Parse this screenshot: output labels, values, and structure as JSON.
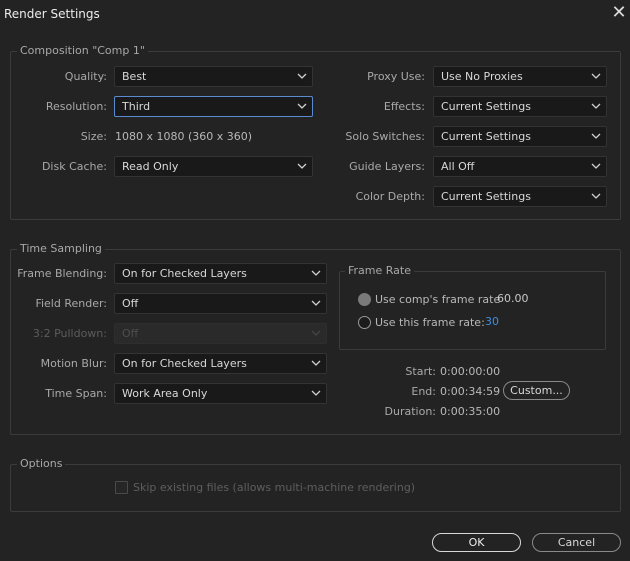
{
  "window": {
    "title": "Render Settings",
    "close_glyph": "✕"
  },
  "composition": {
    "title": "Composition \"Comp 1\"",
    "quality": {
      "label": "Quality:",
      "value": "Best"
    },
    "resolution": {
      "label": "Resolution:",
      "value": "Third"
    },
    "size": {
      "label": "Size:",
      "value": "1080 x 1080 (360 x 360)"
    },
    "disk_cache": {
      "label": "Disk Cache:",
      "value": "Read Only"
    },
    "proxy_use": {
      "label": "Proxy Use:",
      "value": "Use No Proxies"
    },
    "effects": {
      "label": "Effects:",
      "value": "Current Settings"
    },
    "solo_switches": {
      "label": "Solo Switches:",
      "value": "Current Settings"
    },
    "guide_layers": {
      "label": "Guide Layers:",
      "value": "All Off"
    },
    "color_depth": {
      "label": "Color Depth:",
      "value": "Current Settings"
    }
  },
  "time_sampling": {
    "title": "Time Sampling",
    "frame_blending": {
      "label": "Frame Blending:",
      "value": "On for Checked Layers"
    },
    "field_render": {
      "label": "Field Render:",
      "value": "Off"
    },
    "pulldown": {
      "label": "3:2 Pulldown:",
      "value": "Off"
    },
    "motion_blur": {
      "label": "Motion Blur:",
      "value": "On for Checked Layers"
    },
    "time_span": {
      "label": "Time Span:",
      "value": "Work Area Only"
    },
    "frame_rate": {
      "title": "Frame Rate",
      "use_comp": {
        "label": "Use comp's frame rate",
        "value": "60.00",
        "selected": true
      },
      "use_this": {
        "label": "Use this frame rate:",
        "value": "30",
        "selected": false
      }
    },
    "start": {
      "label": "Start:",
      "value": "0:00:00:00"
    },
    "end": {
      "label": "End:",
      "value": "0:00:34:59"
    },
    "duration": {
      "label": "Duration:",
      "value": "0:00:35:00"
    },
    "custom_button": "Custom..."
  },
  "options": {
    "title": "Options",
    "skip_existing": {
      "label": "Skip existing files (allows multi-machine rendering)",
      "checked": false,
      "enabled": false
    }
  },
  "buttons": {
    "ok": "OK",
    "cancel": "Cancel"
  },
  "colors": {
    "background": "#232323",
    "focus": "#5b8ad0",
    "link_value": "#3d8fde"
  },
  "icons": {
    "dropdown": "chevron-down-icon",
    "close": "close-icon"
  }
}
